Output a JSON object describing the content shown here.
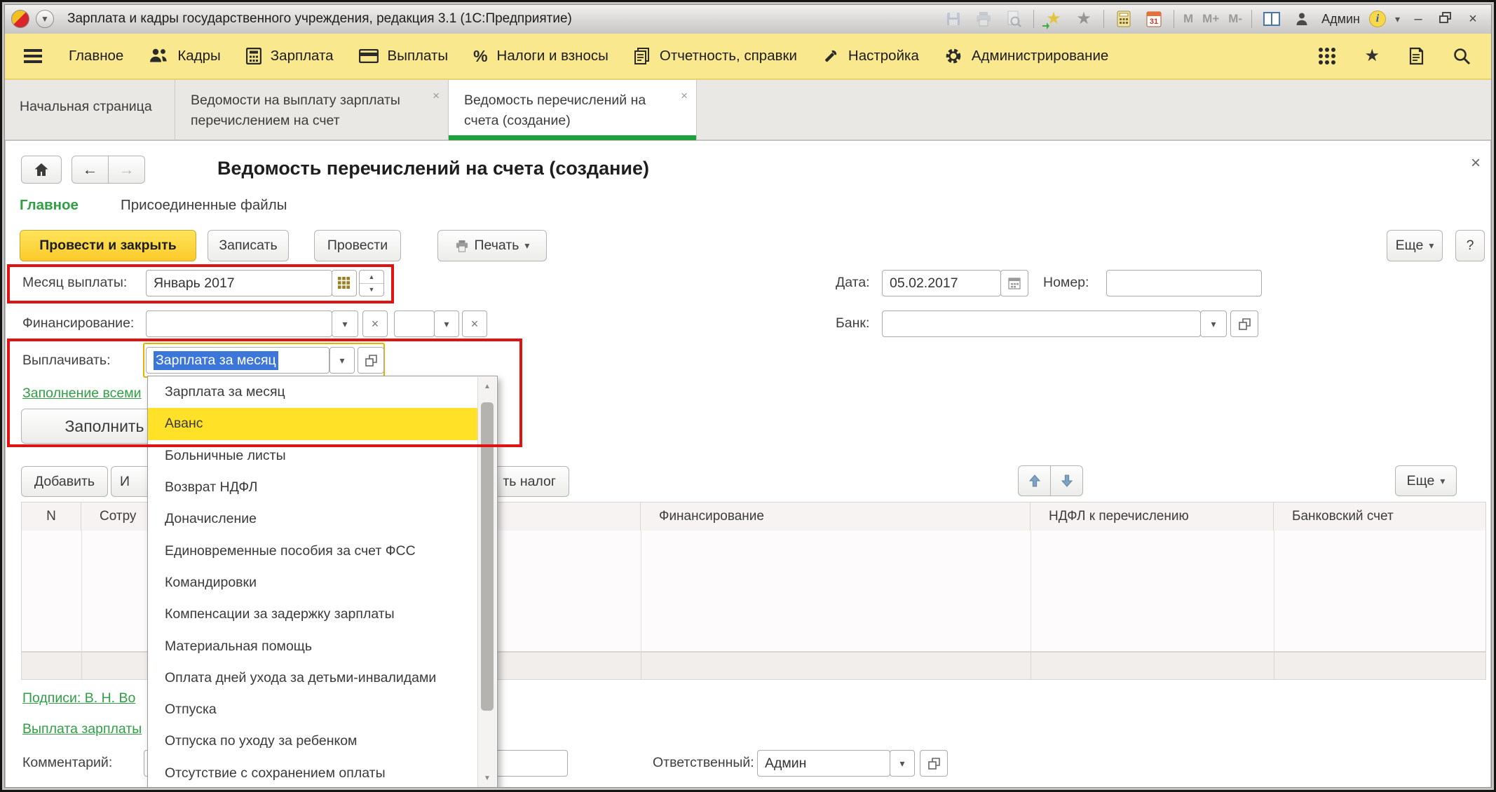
{
  "titlebar": {
    "title": "Зарплата и кадры государственного учреждения, редакция 3.1  (1С:Предприятие)",
    "memory": {
      "m": "M",
      "m_plus": "M+",
      "m_minus": "M-"
    },
    "user": "Админ",
    "info_letter": "i",
    "window_buttons": {
      "minimize": "–",
      "close": "×"
    }
  },
  "menu": {
    "items": [
      {
        "label": "Главное"
      },
      {
        "label": "Кадры"
      },
      {
        "label": "Зарплата"
      },
      {
        "label": "Выплаты"
      },
      {
        "label": "Налоги и взносы"
      },
      {
        "label": "Отчетность, справки"
      },
      {
        "label": "Настройка"
      },
      {
        "label": "Администрирование"
      }
    ],
    "percent_glyph": "%"
  },
  "tabs": {
    "home": "Начальная страница",
    "list_line1": "Ведомости на выплату зарплаты",
    "list_line2": "перечислением на счет",
    "current_line1": "Ведомость перечислений на",
    "current_line2": "счета (создание)",
    "close_glyph": "×"
  },
  "form": {
    "title": "Ведомость перечислений на счета (создание)",
    "close_glyph": "×",
    "nav": {
      "main": "Главное",
      "attached_files": "Присоединенные файлы"
    },
    "toolbar": {
      "post_and_close": "Провести и закрыть",
      "save": "Записать",
      "post": "Провести",
      "print": "Печать",
      "more": "Еще",
      "help": "?"
    },
    "fields": {
      "month": {
        "label": "Месяц выплаты:",
        "value": "Январь 2017"
      },
      "date": {
        "label": "Дата:",
        "value": "05.02.2017"
      },
      "number": {
        "label": "Номер:",
        "value": ""
      },
      "financing": {
        "label": "Финансирование:",
        "value": "",
        "value2": ""
      },
      "bank": {
        "label": "Банк:",
        "value": ""
      },
      "pay": {
        "label": "Выплачивать:",
        "value": "Зарплата за месяц"
      },
      "comment": {
        "label": "Комментарий:",
        "value": ""
      },
      "responsible": {
        "label": "Ответственный:",
        "value": "Админ"
      }
    },
    "links": {
      "fill_all": "Заполнение всеми",
      "signatures": "Подписи: В. Н. Во",
      "salary_payment": "Выплата зарплаты"
    },
    "buttons": {
      "fill": "Заполнить",
      "add": "Добавить",
      "edit_partial": "И",
      "tax_partial": "ть налог",
      "more": "Еще"
    },
    "table": {
      "columns": [
        "N",
        "Сотру",
        "Финансирование",
        "НДФЛ к перечислению",
        "Банковский счет"
      ]
    }
  },
  "dropdown": {
    "items": [
      "Зарплата за месяц",
      "Аванс",
      "Больничные листы",
      "Возврат НДФЛ",
      "Доначисление",
      "Единовременные пособия за счет ФСС",
      "Командировки",
      "Компенсации за задержку зарплаты",
      "Материальная помощь",
      "Оплата дней ухода за детьми-инвалидами",
      "Отпуска",
      "Отпуска по уходу за ребенком",
      "Отсутствие с сохранением оплаты"
    ],
    "highlighted_item": "Аванс"
  },
  "glyphs": {
    "caret_down": "▾",
    "spin_up": "▲",
    "spin_down": "▼",
    "clear": "×",
    "back": "←",
    "forward": "→",
    "star": "★"
  },
  "colors": {
    "menu_yellow": "#f9e88e",
    "accent_green": "#1fa13b",
    "button_yellow": "#fbca2a",
    "annotation_red": "#e01312",
    "selection_blue": "#3b76d8",
    "highlight_yellow": "#ffe227"
  }
}
